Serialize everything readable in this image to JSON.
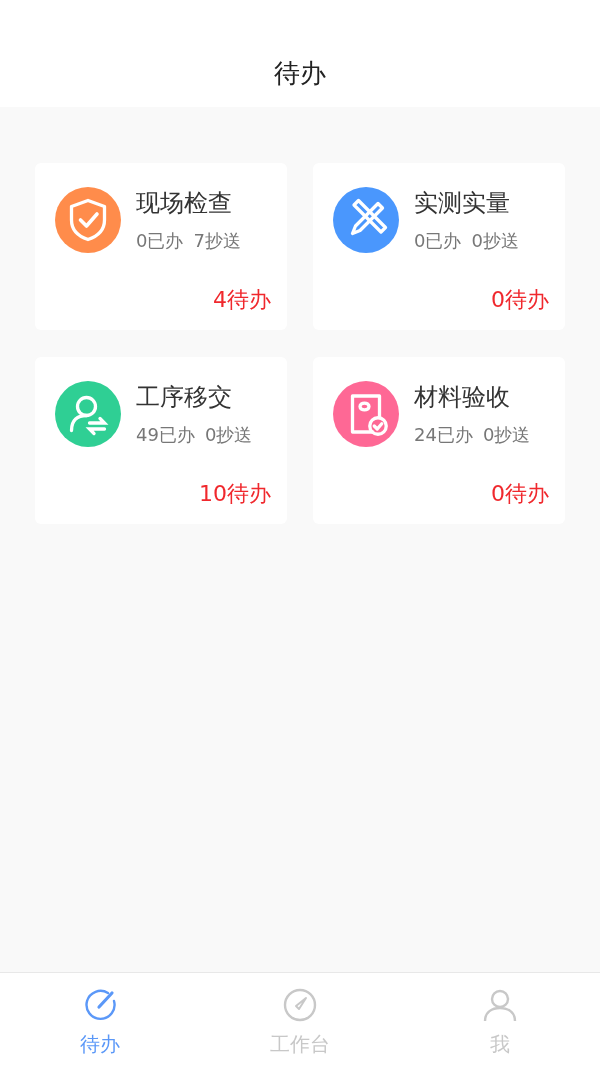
{
  "header": {
    "title": "待办"
  },
  "cards": [
    {
      "color": "#ff8c4b",
      "title": "现场检查",
      "done": "0已办",
      "cc": "7抄送",
      "pending": "4待办"
    },
    {
      "color": "#4a97fd",
      "title": "实测实量",
      "done": "0已办",
      "cc": "0抄送",
      "pending": "0待办"
    },
    {
      "color": "#2fcf94",
      "title": "工序移交",
      "done": "49已办",
      "cc": "0抄送",
      "pending": "10待办"
    },
    {
      "color": "#fe6895",
      "title": "材料验收",
      "done": "24已办",
      "cc": "0抄送",
      "pending": "0待办"
    }
  ],
  "tabs": [
    {
      "label": "待办",
      "selected": true
    },
    {
      "label": "工作台",
      "selected": false
    },
    {
      "label": "我",
      "selected": false
    }
  ]
}
